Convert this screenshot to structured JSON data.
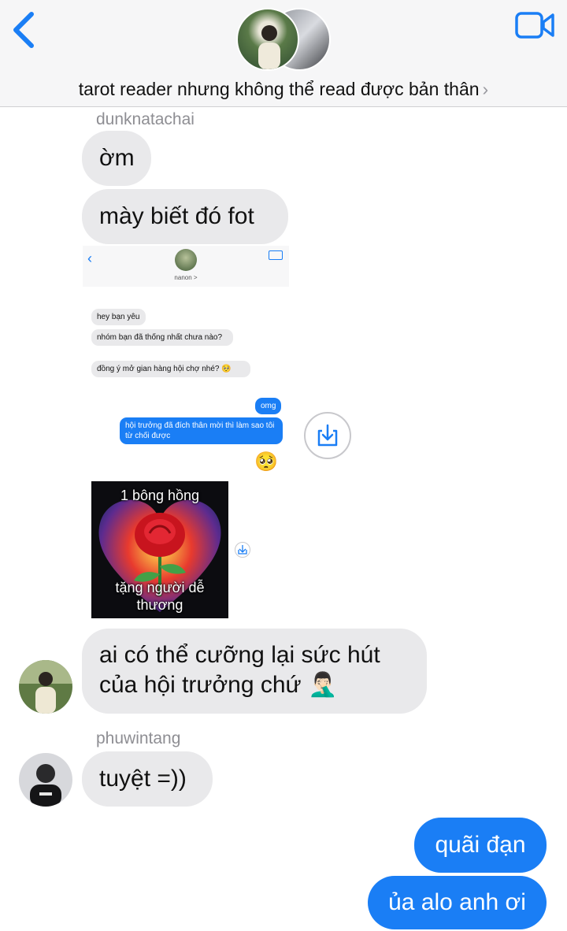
{
  "header": {
    "title": "tarot reader nhưng không thể read được bản thân",
    "chevron": "›",
    "back_icon": "chevron-left-icon",
    "video_icon": "video-camera-icon",
    "accent": "#1a7ef5"
  },
  "messages": {
    "sender1": "dunknatachai",
    "m1": "ờm",
    "m2": "mày biết đó fot",
    "m3_line1": "ai có thể cưỡng lại sức hút",
    "m3_line2": "của hội trưởng chứ",
    "m3_emoji": "🤦🏻‍♂️",
    "sender2": "phuwintang",
    "m4": "tuyệt =))",
    "out1": "quãi đạn",
    "out2": "ủa alo anh ơi"
  },
  "shot": {
    "name": "nanon",
    "chevron": ">",
    "b1": "hey bạn yêu",
    "b2": "nhóm bạn đã thống nhất chưa nào?",
    "b3": "đồng ý mở gian hàng hội chợ nhé? 🥺",
    "b4": "omg",
    "b5": "hội trưởng đã đích thân mời thì làm sao tôi từ chối được",
    "b6": "🥺",
    "rose_top": "1 bông hồng",
    "rose_bottom": "tặng người dễ thương"
  }
}
